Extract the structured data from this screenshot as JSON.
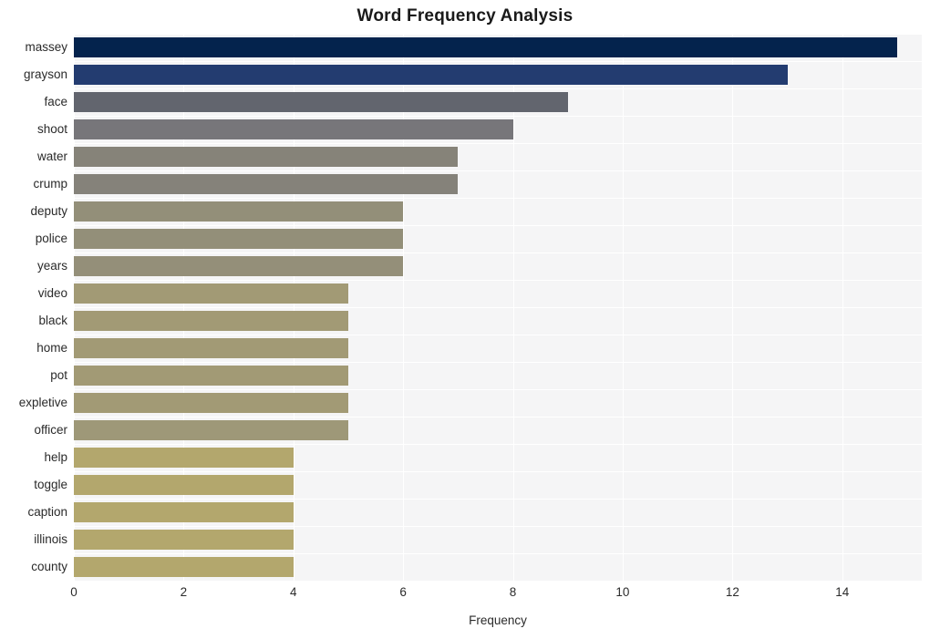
{
  "chart_data": {
    "type": "bar",
    "orientation": "horizontal",
    "title": "Word Frequency Analysis",
    "xlabel": "Frequency",
    "ylabel": "",
    "xlim": [
      0,
      15.45
    ],
    "ylim": [
      0,
      20
    ],
    "grid": true,
    "legend": false,
    "xticks": [
      "0",
      "2",
      "4",
      "6",
      "8",
      "10",
      "12",
      "14"
    ],
    "xtick_values": [
      0,
      2,
      4,
      6,
      8,
      10,
      12,
      14
    ],
    "categories": [
      "massey",
      "grayson",
      "face",
      "shoot",
      "water",
      "crump",
      "deputy",
      "police",
      "years",
      "video",
      "black",
      "home",
      "pot",
      "expletive",
      "officer",
      "help",
      "toggle",
      "caption",
      "illinois",
      "county"
    ],
    "values": [
      15,
      13,
      9,
      8,
      7,
      7,
      6,
      6,
      6,
      5,
      5,
      5,
      5,
      5,
      5,
      4,
      4,
      4,
      4,
      4
    ],
    "bar_colors": [
      "#04234d",
      "#233c70",
      "#62656e",
      "#77767a",
      "#868379",
      "#85827a",
      "#938f79",
      "#938f79",
      "#948f79",
      "#a29a75",
      "#a29a75",
      "#a29a75",
      "#a29a75",
      "#a29a75",
      "#9e9878",
      "#b3a76d",
      "#b3a76d",
      "#b3a76d",
      "#b3a76d",
      "#b3a76d"
    ],
    "plot_background": "#f5f5f6",
    "gridline_color": "#ffffff",
    "text_color": "#2a2a2a",
    "title_color": "#1a1a1a"
  }
}
